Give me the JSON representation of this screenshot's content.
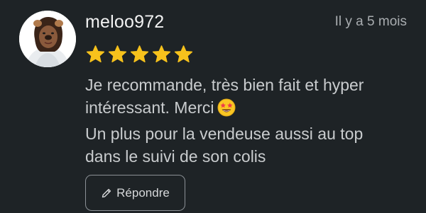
{
  "review": {
    "username": "meloo972",
    "timestamp": "Il y a 5 mois",
    "rating": 5,
    "rating_max": 5,
    "text_lines": [
      "Je recommande, très bien fait et hyper",
      "intéressant. Merci",
      "Un plus pour la vendeuse aussi au top",
      "dans le suivi de son colis"
    ],
    "emoji_icon": "star-struck-emoji-icon"
  },
  "actions": {
    "reply_label": "Répondre",
    "reply_icon": "pencil-icon"
  },
  "colors": {
    "background": "#1e2326",
    "star": "#f7c21c",
    "text": "#c9ccce",
    "muted": "#a9adb0",
    "button_border": "#8c9196"
  }
}
